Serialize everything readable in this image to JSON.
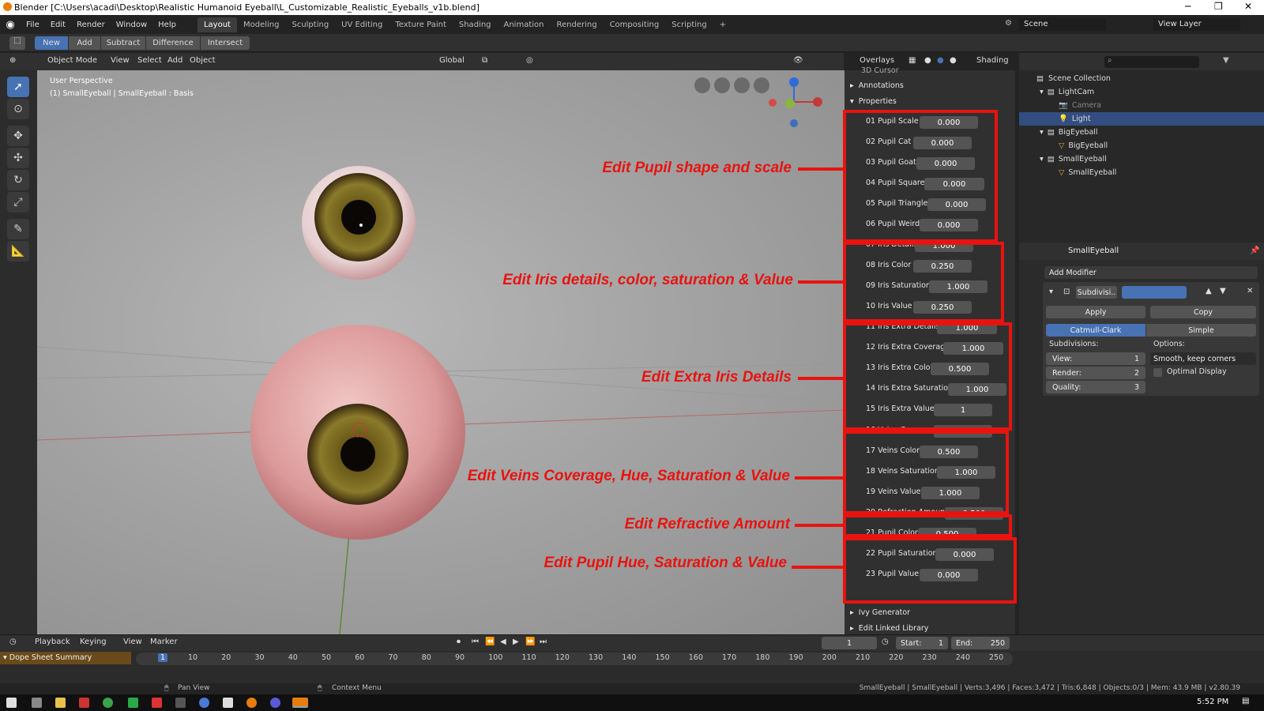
{
  "window": {
    "title": "Blender [C:\\Users\\acadi\\Desktop\\Realistic Humanoid Eyeball\\L_Customizable_Realistic_Eyeballs_v1b.blend]"
  },
  "menu": [
    "File",
    "Edit",
    "Render",
    "Window",
    "Help"
  ],
  "workspaces": [
    "Layout",
    "Modeling",
    "Sculpting",
    "UV Editing",
    "Texture Paint",
    "Shading",
    "Animation",
    "Rendering",
    "Compositing",
    "Scripting",
    "+"
  ],
  "scene": {
    "label": "Scene",
    "viewlayer": "View Layer"
  },
  "boolean_ops": [
    "New",
    "Add",
    "Subtract",
    "Difference",
    "Intersect"
  ],
  "viewport_header": {
    "mode": "Object Mode",
    "view": "View",
    "select": "Select",
    "add": "Add",
    "object": "Object",
    "orientation": "Global",
    "overlays": "Overlays",
    "shading": "Shading"
  },
  "viewport": {
    "perspective": "User Perspective",
    "object_info": "(1) SmallEyeball | SmallEyeball : Basis"
  },
  "npanel": {
    "cut_top": "3D Cursor",
    "annotations": "Annotations",
    "properties": "Properties",
    "ivy": "Ivy Generator",
    "linked": "Edit Linked Library"
  },
  "properties_list": [
    {
      "label": "01 Pupil Scale",
      "value": "0.000"
    },
    {
      "label": "02 Pupil Cat",
      "value": "0.000"
    },
    {
      "label": "03 Pupil Goat",
      "value": "0.000"
    },
    {
      "label": "04 Pupil Square",
      "value": "0.000"
    },
    {
      "label": "05 Pupil Triangle",
      "value": "0.000"
    },
    {
      "label": "06 Pupil Weird",
      "value": "0.000"
    },
    {
      "label": "07 Iris Details",
      "value": "1.000"
    },
    {
      "label": "08 Iris Color",
      "value": "0.250"
    },
    {
      "label": "09 Iris Saturation",
      "value": "1.000"
    },
    {
      "label": "10 Iris Value",
      "value": "0.250"
    },
    {
      "label": "11 Iris Extra Details",
      "value": "1.000"
    },
    {
      "label": "12 Iris Extra Coverage",
      "value": "1.000"
    },
    {
      "label": "13 Iris Extra Color",
      "value": "0.500"
    },
    {
      "label": "14 Iris Extra Saturation",
      "value": "1.000"
    },
    {
      "label": "15 Iris Extra Value",
      "value": "1"
    },
    {
      "label": "16 Veins Coverage",
      "value": "1.000"
    },
    {
      "label": "17 Veins Color",
      "value": "0.500"
    },
    {
      "label": "18 Veins Saturation",
      "value": "1.000"
    },
    {
      "label": "19 Veins Value",
      "value": "1.000"
    },
    {
      "label": "20 Refraction Amount",
      "value": "0.500"
    },
    {
      "label": "21 Pupil Color",
      "value": "0.500"
    },
    {
      "label": "22 Pupil Saturation",
      "value": "0.000"
    },
    {
      "label": "23 Pupil Value",
      "value": "0.000"
    }
  ],
  "annotations": [
    "Edit Pupil shape and scale",
    "Edit Iris details, color, saturation & Value",
    "Edit Extra Iris Details",
    "Edit Veins Coverage, Hue, Saturation & Value",
    "Edit Refractive Amount",
    "Edit Pupil Hue, Saturation & Value"
  ],
  "outliner": {
    "collection": "Scene Collection",
    "items": [
      "LightCam",
      "Camera",
      "Light",
      "BigEyeball",
      "BigEyeball",
      "SmallEyeball",
      "SmallEyeball"
    ]
  },
  "props": {
    "object": "SmallEyeball",
    "add_modifier": "Add Modifier",
    "modifier_name": "Subdivisi..",
    "apply": "Apply",
    "copy": "Copy",
    "catmull": "Catmull-Clark",
    "simple": "Simple",
    "subdivisions": "Subdivisions:",
    "options": "Options:",
    "view_label": "View:",
    "view_val": "1",
    "render_label": "Render:",
    "render_val": "2",
    "quality_label": "Quality:",
    "quality_val": "3",
    "smooth": "Smooth, keep corners",
    "optimal": "Optimal Display"
  },
  "timeline": {
    "playback": "Playback",
    "keying": "Keying",
    "view": "View",
    "marker": "Marker",
    "current": "1",
    "start_label": "Start:",
    "start": "1",
    "end_label": "End:",
    "end": "250",
    "dope": "Dope Sheet Summary",
    "ticks": [
      "1",
      "10",
      "20",
      "30",
      "40",
      "50",
      "60",
      "70",
      "80",
      "90",
      "100",
      "110",
      "120",
      "130",
      "140",
      "150",
      "160",
      "170",
      "180",
      "190",
      "200",
      "210",
      "220",
      "230",
      "240",
      "250"
    ]
  },
  "status": {
    "pan": "Pan View",
    "context": "Context Menu",
    "info": "SmallEyeball | SmallEyeball | Verts:3,496 | Faces:3,472 | Tris:6,848 | Objects:0/3 | Mem: 43.9 MB | v2.80.39"
  },
  "taskbar": {
    "time": "5:52 PM"
  }
}
